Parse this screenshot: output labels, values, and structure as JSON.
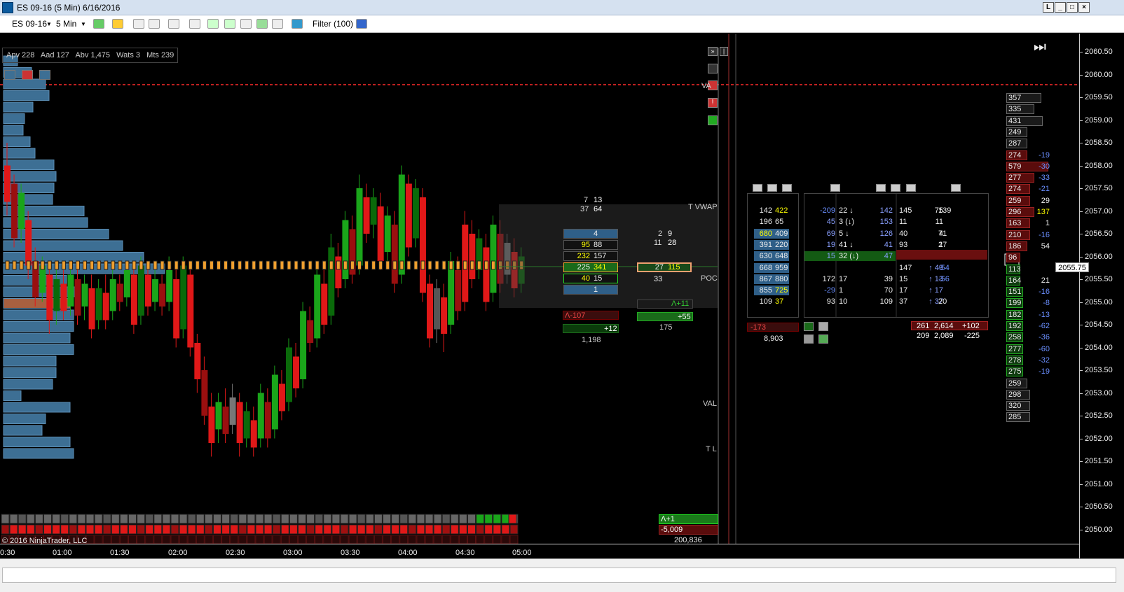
{
  "window": {
    "title": "ES 09-16 (5 Min)  6/16/2016"
  },
  "toolbar": {
    "instrument": "ES 09-16",
    "interval": "5 Min",
    "filter": "Filter (100)"
  },
  "stats": {
    "text": "Apv 228   Aad 127   Abv 1,475   Wats 3   Mts 239"
  },
  "labels": {
    "vwap": "T VWAP",
    "poc": "POC",
    "val": "VAL",
    "tl": "T L",
    "va": "VA",
    "copyright": "© 2016 NinjaTrader, LLC"
  },
  "price_axis": [
    "2060.50",
    "2060.00",
    "2059.50",
    "2059.00",
    "2058.50",
    "2058.00",
    "2057.50",
    "2057.00",
    "2056.50",
    "2056.00",
    "2055.50",
    "2055.00",
    "2054.50",
    "2054.00",
    "2053.50",
    "2053.00",
    "2052.50",
    "2052.00",
    "2051.50",
    "2051.00",
    "2050.50",
    "2050.00"
  ],
  "current_price": "2055.75",
  "time_axis": [
    "0:30",
    "01:00",
    "01:30",
    "02:00",
    "02:30",
    "03:00",
    "03:30",
    "04:00",
    "04:30",
    "05:00"
  ],
  "footprint1": {
    "top": [
      "7",
      "13",
      "37",
      "64"
    ],
    "rows": [
      [
        "",
        "4"
      ],
      [
        "95",
        "88"
      ],
      [
        "232",
        "157"
      ],
      [
        "225",
        "341"
      ],
      [
        "40",
        "15"
      ],
      [
        "",
        "1"
      ]
    ],
    "delta": "Λ-107",
    "pos": "+12",
    "vol": "1,198"
  },
  "footprint2": {
    "top": [
      "2",
      "9",
      "11",
      "28"
    ],
    "rows": [
      [
        "27",
        "115"
      ],
      [
        "",
        "33"
      ]
    ],
    "delta": "Λ+11",
    "pos": "+55",
    "vol": "175"
  },
  "ladder1": {
    "rows": [
      [
        "142",
        "422"
      ],
      [
        "196",
        "65"
      ],
      [
        "680",
        "409"
      ],
      [
        "391",
        "220"
      ],
      [
        "630",
        "648"
      ],
      [
        "668",
        "959"
      ],
      [
        "867",
        "880"
      ],
      [
        "855",
        "725"
      ],
      [
        "109",
        "37"
      ]
    ],
    "total_delta": "-173",
    "total_vol": "8,903"
  },
  "ladder2": {
    "rows": [
      [
        "-209",
        "22 ↓",
        "142",
        "145",
        "75",
        "139"
      ],
      [
        "45",
        "3 (↓)",
        "153",
        "11",
        "11",
        ""
      ],
      [
        "69",
        "5 ↓",
        "126",
        "40",
        "4",
        "71"
      ],
      [
        "19",
        "41 ↓",
        "41",
        "93",
        "1",
        "27"
      ],
      [
        "15",
        "32 (↓)",
        "47",
        "",
        "",
        ""
      ],
      [
        "",
        "",
        "",
        "147",
        "↑ 49",
        "-54"
      ],
      [
        "172",
        "17",
        "39",
        "15",
        "↑ 13",
        "-56"
      ],
      [
        "-29",
        "1",
        "70",
        "17",
        "↑ 17",
        ""
      ],
      [
        "93",
        "10",
        "109",
        "37",
        "↑ 37",
        "20"
      ]
    ],
    "sum_a": [
      "261",
      "2,614",
      "+102"
    ],
    "sum_b": [
      "209",
      "2,089",
      "-225"
    ]
  },
  "depth": {
    "rows": [
      [
        "357",
        "",
        ""
      ],
      [
        "335",
        "",
        ""
      ],
      [
        "431",
        "",
        ""
      ],
      [
        "249",
        "",
        ""
      ],
      [
        "287",
        "",
        ""
      ],
      [
        "274",
        "-19",
        ""
      ],
      [
        "579",
        "-30",
        ""
      ],
      [
        "277",
        "-33",
        ""
      ],
      [
        "274",
        "-21",
        ""
      ],
      [
        "259",
        "29",
        ""
      ],
      [
        "296",
        "137",
        ""
      ],
      [
        "163",
        "1",
        ""
      ],
      [
        "210",
        "-16",
        ""
      ],
      [
        "186",
        "54",
        ""
      ],
      [
        "96",
        "",
        ""
      ],
      [
        "113",
        "",
        ""
      ],
      [
        "164",
        "21",
        ""
      ],
      [
        "151",
        "-16",
        ""
      ],
      [
        "199",
        "-8",
        ""
      ],
      [
        "182",
        "-13",
        ""
      ],
      [
        "192",
        "-62",
        ""
      ],
      [
        "258",
        "-36",
        ""
      ],
      [
        "277",
        "-60",
        ""
      ],
      [
        "278",
        "-32",
        ""
      ],
      [
        "275",
        "-19",
        ""
      ],
      [
        "259",
        "",
        ""
      ],
      [
        "298",
        "",
        ""
      ],
      [
        "320",
        "",
        ""
      ],
      [
        "285",
        "",
        ""
      ]
    ]
  },
  "bottom_summary": {
    "delta": "Λ+1",
    "neg": "-5,009",
    "vol": "200,836"
  },
  "colors": {
    "up": "#1aa51a",
    "down": "#e01818",
    "profile": "#3d6f94",
    "poc": "#a86040",
    "accent_line": "#ff2a2a"
  }
}
